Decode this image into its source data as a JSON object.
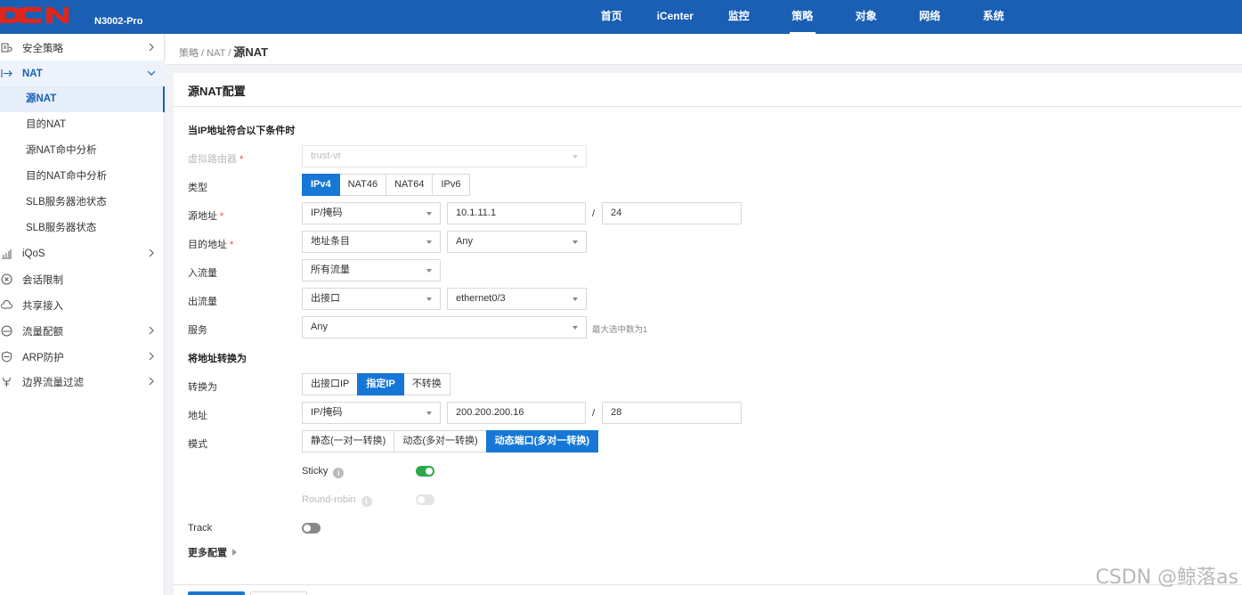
{
  "header": {
    "logo_text": "DCN",
    "model": "N3002-Pro",
    "nav": [
      "首页",
      "iCenter",
      "监控",
      "策略",
      "对象",
      "网络",
      "系统"
    ],
    "active_nav": "策略"
  },
  "sidebar": {
    "items": [
      {
        "label": "安全策略",
        "icon": "shield-list-icon"
      },
      {
        "label": "NAT",
        "icon": "nat-arrow-icon"
      },
      {
        "label": "iQoS",
        "icon": "bar-chart-icon"
      },
      {
        "label": "会话限制",
        "icon": "circle-x-icon"
      },
      {
        "label": "共享接入",
        "icon": "cloud-icon"
      },
      {
        "label": "流量配额",
        "icon": "gauge-icon"
      },
      {
        "label": "ARP防护",
        "icon": "shield-icon"
      },
      {
        "label": "边界流量过滤",
        "icon": "filter-icon"
      }
    ],
    "nat_subitems": [
      "源NAT",
      "目的NAT",
      "源NAT命中分析",
      "目的NAT命中分析",
      "SLB服务器池状态",
      "SLB服务器状态"
    ]
  },
  "breadcrumb": {
    "path": "策略 / NAT /",
    "current": "源NAT"
  },
  "form": {
    "title": "源NAT配置",
    "section_match": "当IP地址符合以下条件时",
    "virtual_router": {
      "label": "虚拟路由器",
      "value": "trust-vr"
    },
    "type": {
      "label": "类型",
      "options": [
        "IPv4",
        "NAT46",
        "NAT64",
        "IPv6"
      ],
      "selected": "IPv4"
    },
    "src_addr": {
      "label": "源地址",
      "mode": "IP/掩码",
      "ip": "10.1.11.1",
      "slash": "/",
      "mask": "24"
    },
    "dst_addr": {
      "label": "目的地址",
      "mode": "地址条目",
      "value": "Any"
    },
    "ingress": {
      "label": "入流量",
      "value": "所有流量"
    },
    "egress": {
      "label": "出流量",
      "mode": "出接口",
      "value": "ethernet0/3"
    },
    "service": {
      "label": "服务",
      "value": "Any",
      "hint": "最大选中数为1"
    },
    "section_translate": "将地址转换为",
    "translate_to": {
      "label": "转换为",
      "options": [
        "出接口IP",
        "指定IP",
        "不转换"
      ],
      "selected": "指定IP"
    },
    "address": {
      "label": "地址",
      "mode": "IP/掩码",
      "ip": "200.200.200.16",
      "slash": "/",
      "mask": "28"
    },
    "mode": {
      "label": "模式",
      "options": [
        "静态(一对一转换)",
        "动态(多对一转换)",
        "动态端口(多对一转换)"
      ],
      "selected": "动态端口(多对一转换)"
    },
    "sticky": {
      "label": "Sticky",
      "on": true
    },
    "round_robin": {
      "label": "Round-robin",
      "on": false
    },
    "track": {
      "label": "Track",
      "on": false
    },
    "more": "更多配置"
  },
  "watermark": "CSDN @鲸落as",
  "colors": {
    "brand": "#1a5fb4",
    "accent": "#1677d6",
    "toggle_on": "#2aa84a"
  }
}
